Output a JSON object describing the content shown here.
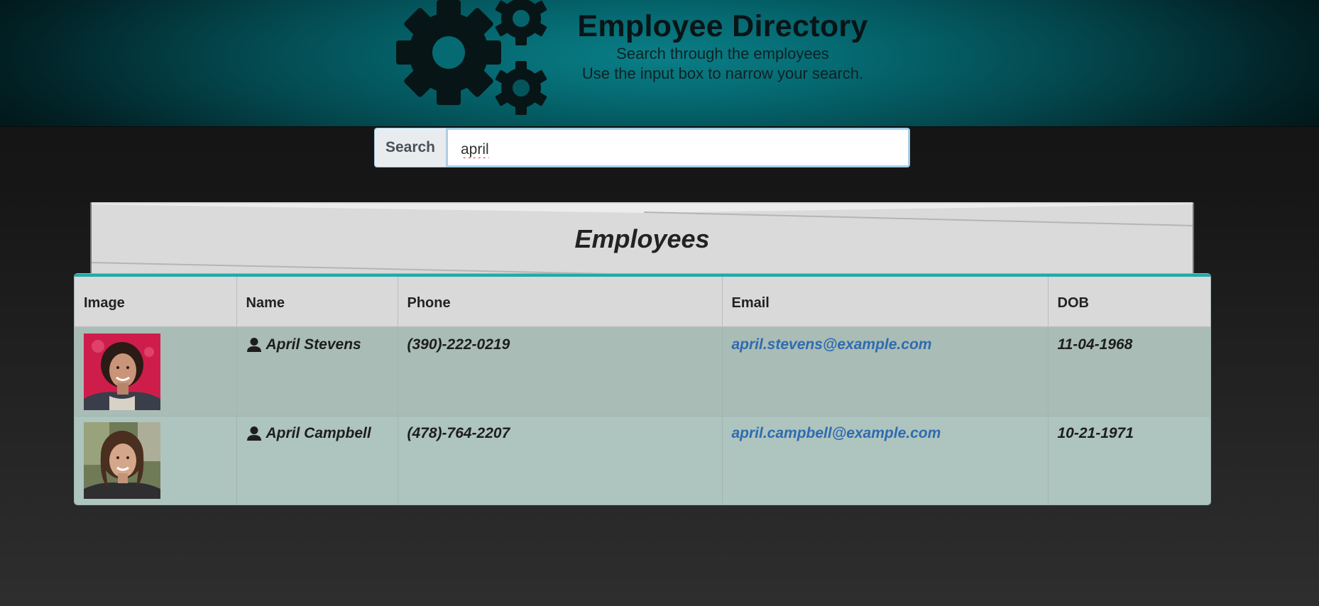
{
  "header": {
    "title": "Employee Directory",
    "subtitle_1": "Search through the employees",
    "subtitle_2": "Use the input box to narrow your search."
  },
  "search": {
    "label": "Search",
    "value": "april"
  },
  "banner": {
    "title": "Employees"
  },
  "table": {
    "columns": [
      "Image",
      "Name",
      "Phone",
      "Email",
      "DOB"
    ],
    "rows": [
      {
        "name": "April Stevens",
        "phone": "(390)-222-0219",
        "email": "april.stevens@example.com",
        "dob": "11-04-1968",
        "avatar_bg": "#cf1d4b"
      },
      {
        "name": "April Campbell",
        "phone": "(478)-764-2207",
        "email": "april.campbell@example.com",
        "dob": "10-21-1971",
        "avatar_bg": "#6f7a57"
      }
    ]
  },
  "colors": {
    "accent_teal": "#24a9a8",
    "link_blue": "#2f6bb0",
    "header_teal": "#056870"
  },
  "icons": {
    "header": "gears-icon",
    "name_cell": "user-icon"
  }
}
